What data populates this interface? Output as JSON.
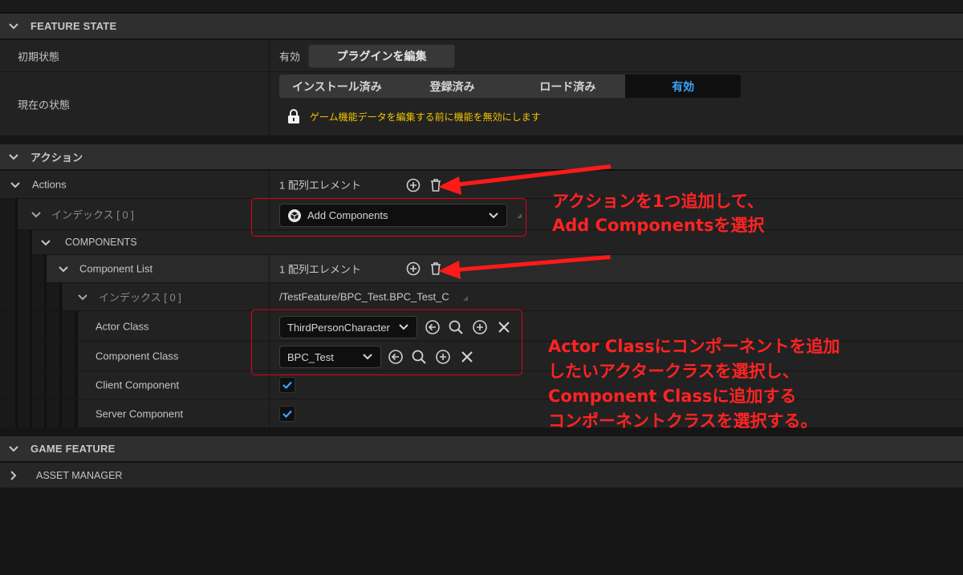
{
  "sections": {
    "feature_state": "FEATURE STATE",
    "actions": "アクション",
    "game_feature": "GAME FEATURE",
    "asset_manager": "ASSET MANAGER"
  },
  "feature_state": {
    "initial_state_label": "初期状態",
    "initial_state_value": "有効",
    "edit_plugin_button": "プラグインを編集",
    "current_state_label": "現在の状態",
    "states": [
      "インストール済み",
      "登録済み",
      "ロード済み",
      "有効"
    ],
    "active_state_index": 3,
    "warning": "ゲーム機能データを編集する前に機能を無効にします"
  },
  "actions": {
    "actions_label": "Actions",
    "actions_count": "1 配列エレメント",
    "index0_label": "インデックス [ 0 ]",
    "index0_value": "Add Components",
    "components_label": "COMPONENTS",
    "component_list_label": "Component List",
    "component_list_count": "1 配列エレメント",
    "cl_index0_label": "インデックス [ 0 ]",
    "cl_index0_value": "/TestFeature/BPC_Test.BPC_Test_C",
    "actor_class_label": "Actor Class",
    "actor_class_value": "ThirdPersonCharacter",
    "component_class_label": "Component Class",
    "component_class_value": "BPC_Test",
    "client_component_label": "Client Component",
    "client_component_checked": true,
    "server_component_label": "Server Component",
    "server_component_checked": true
  },
  "annotations": {
    "callout1_line1": "アクションを1つ追加して、",
    "callout1_line2": "Add Componentsを選択",
    "callout2_line1": "Actor Classにコンポーネントを追加",
    "callout2_line2": "したいアクタークラスを選択し、",
    "callout2_line3": "Component Classに追加する",
    "callout2_line4": "コンポーネントクラスを選択する。"
  },
  "colors": {
    "accent_blue": "#3ea3ff",
    "warning_yellow": "#f0c400",
    "annotation_red": "#ff2323"
  }
}
